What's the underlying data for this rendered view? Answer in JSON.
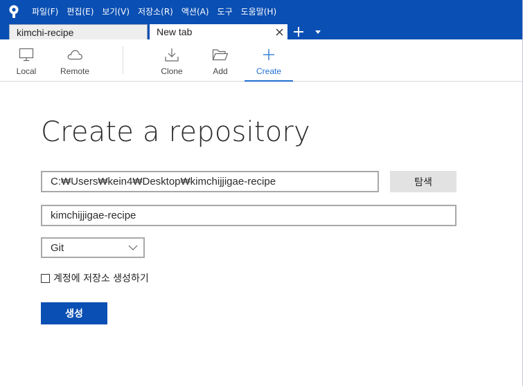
{
  "menu": {
    "items": [
      "파일(F)",
      "편집(E)",
      "보기(V)",
      "저장소(R)",
      "액션(A)",
      "도구",
      "도움말(H)"
    ]
  },
  "tabs": [
    {
      "label": "kimchi-recipe",
      "active": false
    },
    {
      "label": "New tab",
      "active": true
    }
  ],
  "toolbar": {
    "local": "Local",
    "remote": "Remote",
    "clone": "Clone",
    "add": "Add",
    "create": "Create"
  },
  "form": {
    "title": "Create a repository",
    "path_value": "C:₩Users₩kein4₩Desktop₩kimchijjigae-recipe",
    "browse_label": "탐색",
    "name_value": "kimchijjigae-recipe",
    "vcs_selected": "Git",
    "account_checkbox_label": "계정에 저장소 생성하기",
    "account_checked": false,
    "create_label": "생성"
  },
  "colors": {
    "brand": "#0a4fb3",
    "accent": "#1f6fd0"
  },
  "icons": {
    "app": "sourcetree-logo-icon",
    "local": "monitor-icon",
    "remote": "cloud-icon",
    "clone": "download-icon",
    "add": "folder-open-icon",
    "create": "plus-icon"
  }
}
